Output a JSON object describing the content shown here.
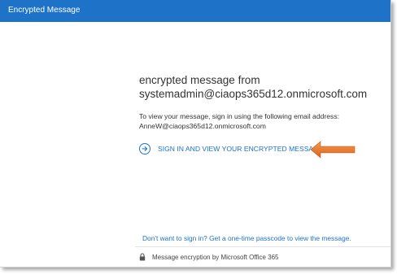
{
  "window": {
    "title": "Encrypted Message"
  },
  "message": {
    "heading": "encrypted message from",
    "sender": "systemadmin@ciaops365d12.onmicrosoft.com",
    "instruction": "To view your message, sign in using the following email address:",
    "recipient_email": "AnneW@ciaops365d12.onmicrosoft.com"
  },
  "actions": {
    "signin_label": "SIGN IN AND VIEW YOUR ENCRYPTED MESSAGE",
    "onetime_passcode_link": "Don't want to sign in? Get a one-time passcode to view the message."
  },
  "footer": {
    "text": "Message encryption by Microsoft Office 365"
  },
  "colors": {
    "accent": "#1e73c8",
    "annotation_arrow": "#e8782e"
  },
  "icons": {
    "signin": "arrow-right-circle-icon",
    "annotation": "orange-arrow-icon",
    "footer": "lock-icon"
  }
}
